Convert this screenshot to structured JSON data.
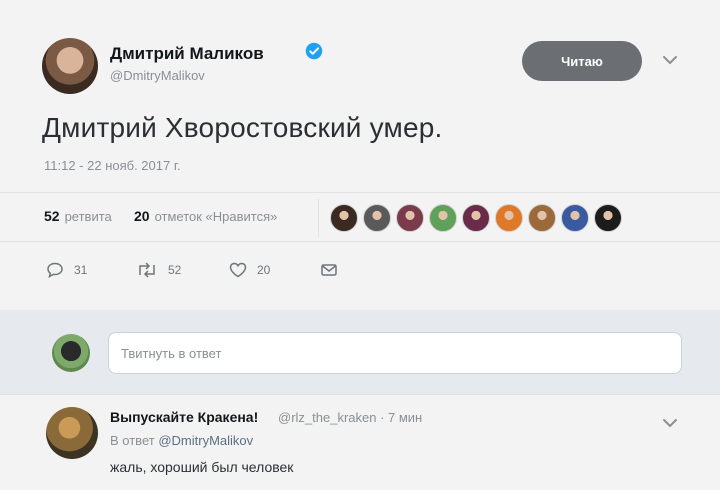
{
  "tweet": {
    "author_name": "Дмитрий Маликов",
    "author_handle": "@DmitryMalikov",
    "follow_label": "Читаю",
    "text": "Дмитрий Хворостовский умер.",
    "timestamp": "11:12 - 22 нояб. 2017 г.",
    "retweets_count": "52",
    "retweets_label": "ретвита",
    "likes_count": "20",
    "likes_label": "отметок «Нравится»",
    "liker_avatar_colors": [
      "#3a2a22",
      "#5a5a5a",
      "#7a3b4a",
      "#5fa05a",
      "#6a2a4a",
      "#e0782a",
      "#9a6a3a",
      "#3a5aa0",
      "#1c1c1c"
    ],
    "actions": {
      "reply_count": "31",
      "retweet_count": "52",
      "like_count": "20"
    }
  },
  "reply_box": {
    "placeholder": "Твитнуть в ответ"
  },
  "reply": {
    "author_name": "Выпускайте Кракена!",
    "meta": "@rlz_the_kraken · 7 мин",
    "in_reply_prefix": "В ответ",
    "in_reply_handle": "@DmitryMalikov",
    "text": "жаль, хороший был человек"
  },
  "colors": {
    "verified": "#1da1f2",
    "follow_button_bg": "#6b6e72",
    "card_bg": "#f3f3f4",
    "reply_area_bg": "#e6eaee"
  }
}
